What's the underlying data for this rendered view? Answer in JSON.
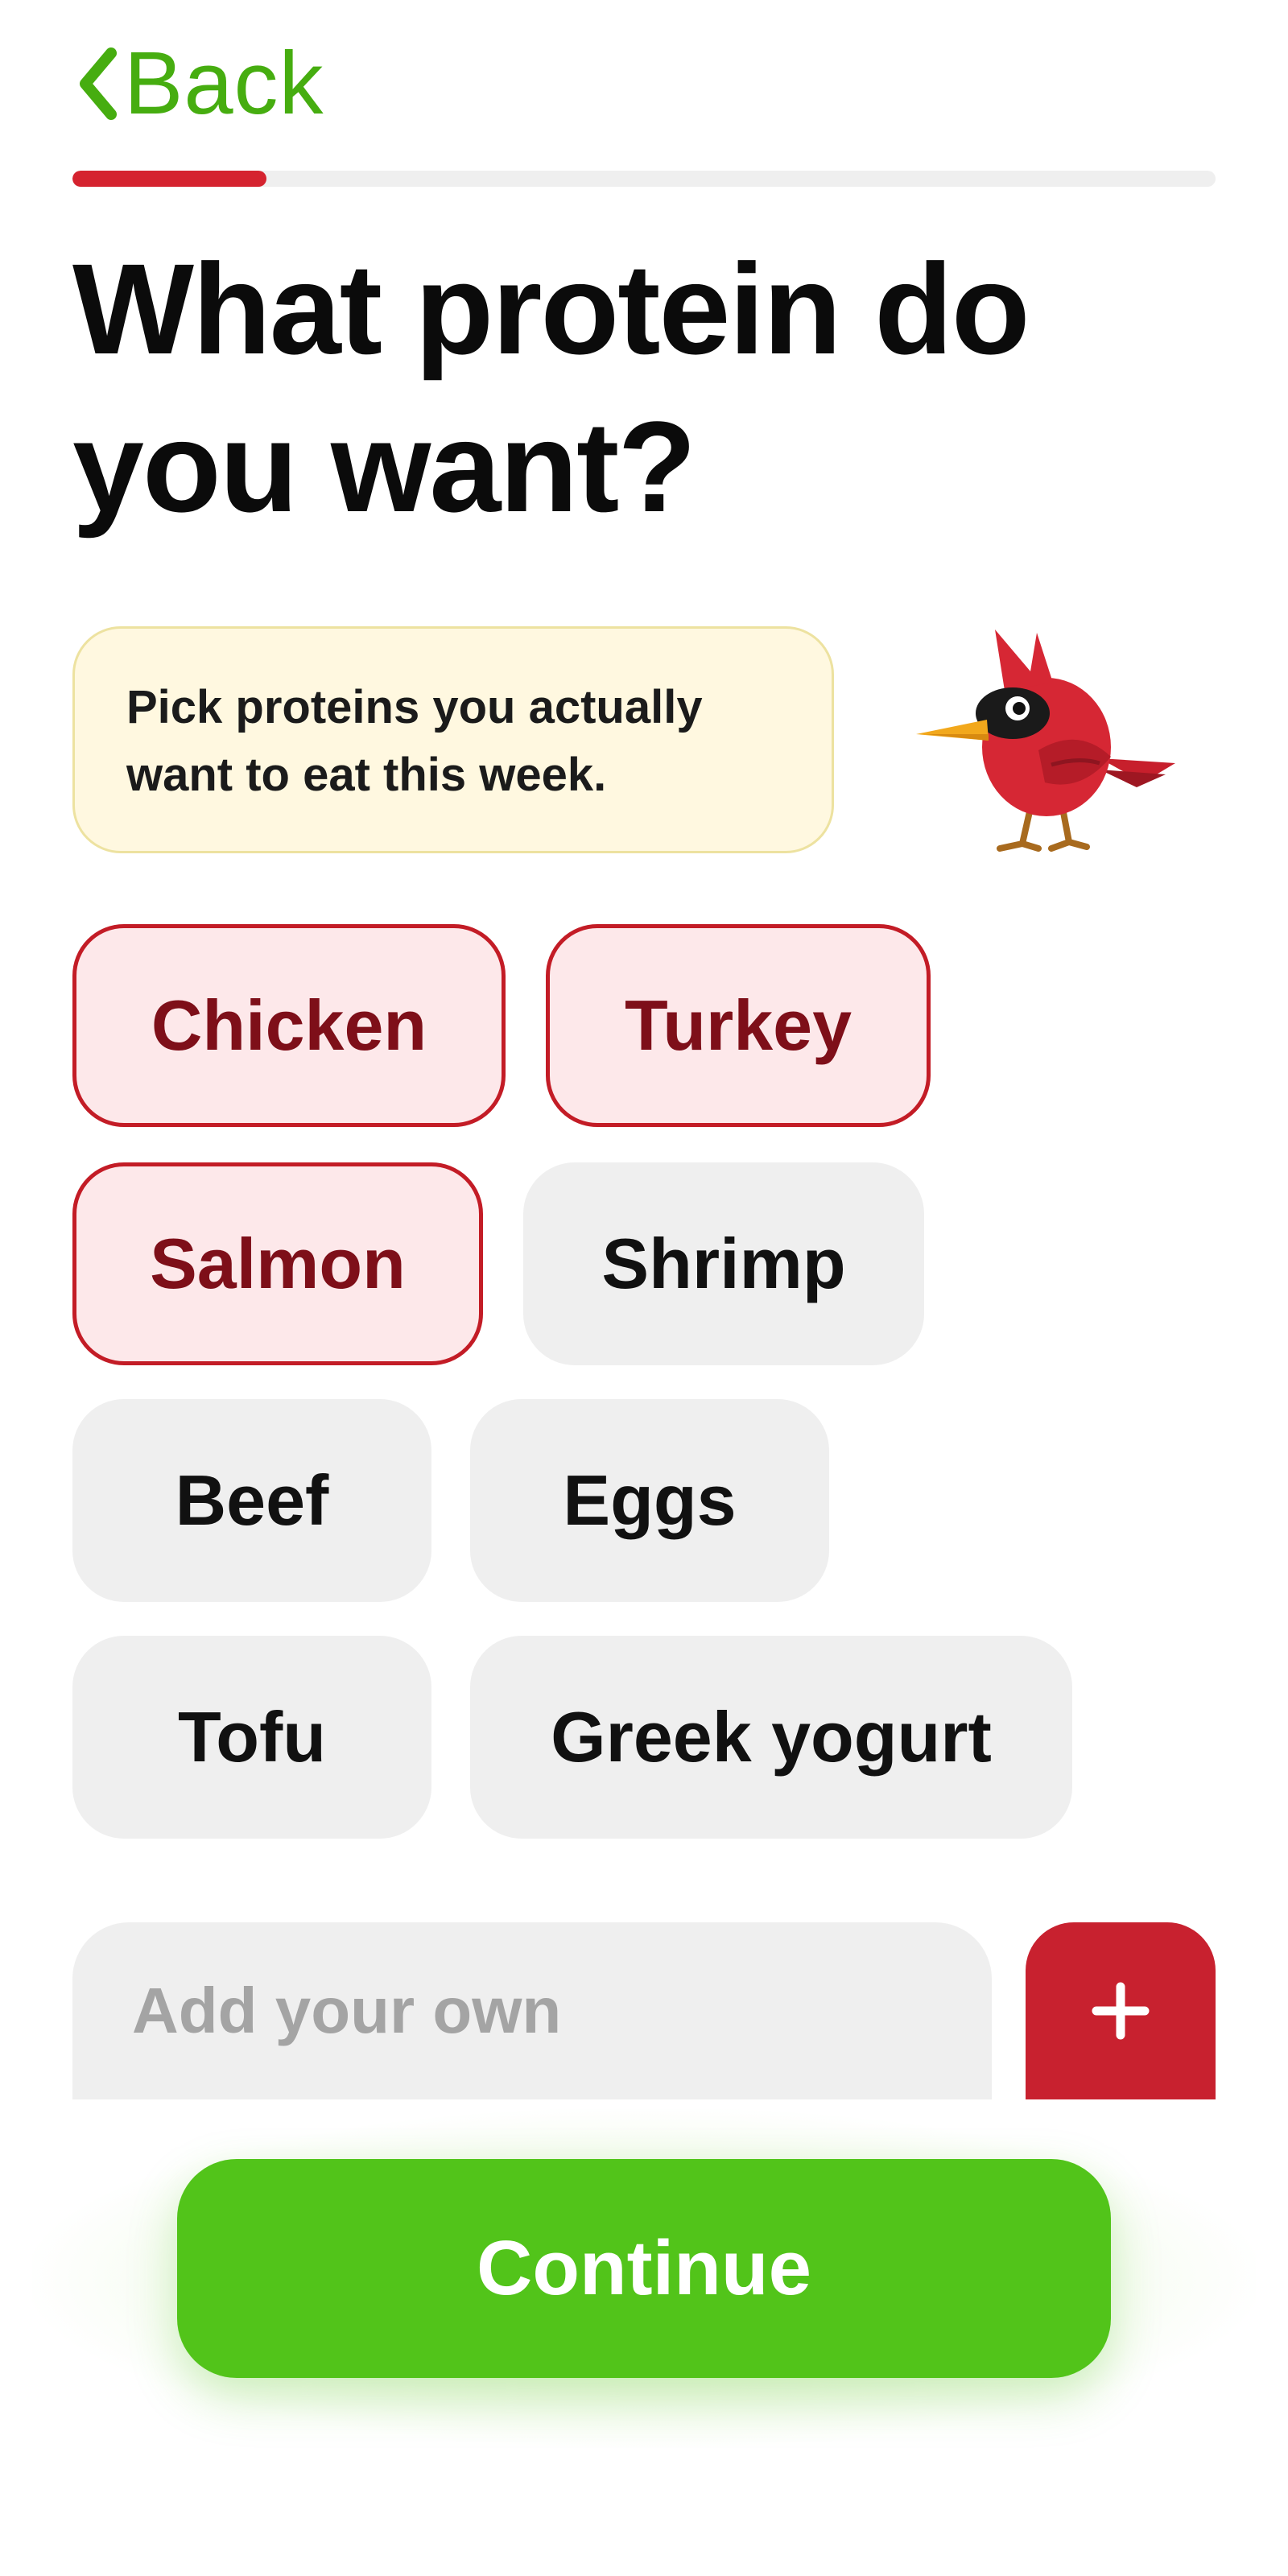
{
  "nav": {
    "back_label": "Back"
  },
  "progress": {
    "fraction": 0.17,
    "fill_color": "#d5232f",
    "track_color": "#efefef"
  },
  "title": "What protein do you want?",
  "hint": {
    "line1": "Pick proteins you actually",
    "line2": "want to eat this week."
  },
  "mascot": {
    "icon": "cardinal-bird-icon"
  },
  "proteins": [
    {
      "label": "Chicken",
      "selected": true
    },
    {
      "label": "Turkey",
      "selected": true
    },
    {
      "label": "Salmon",
      "selected": true
    },
    {
      "label": "Shrimp",
      "selected": false
    },
    {
      "label": "Beef",
      "selected": false
    },
    {
      "label": "Eggs",
      "selected": false
    },
    {
      "label": "Tofu",
      "selected": false
    },
    {
      "label": "Greek yogurt",
      "selected": false
    }
  ],
  "custom": {
    "placeholder": "Add your own",
    "value": "",
    "add_icon": "plus-icon"
  },
  "continue_label": "Continue",
  "colors": {
    "accent_green": "#52c41a",
    "back_green": "#46ad10",
    "selected_border": "#c31c26",
    "selected_bg": "#fde8ea",
    "add_button": "#c8212f"
  }
}
